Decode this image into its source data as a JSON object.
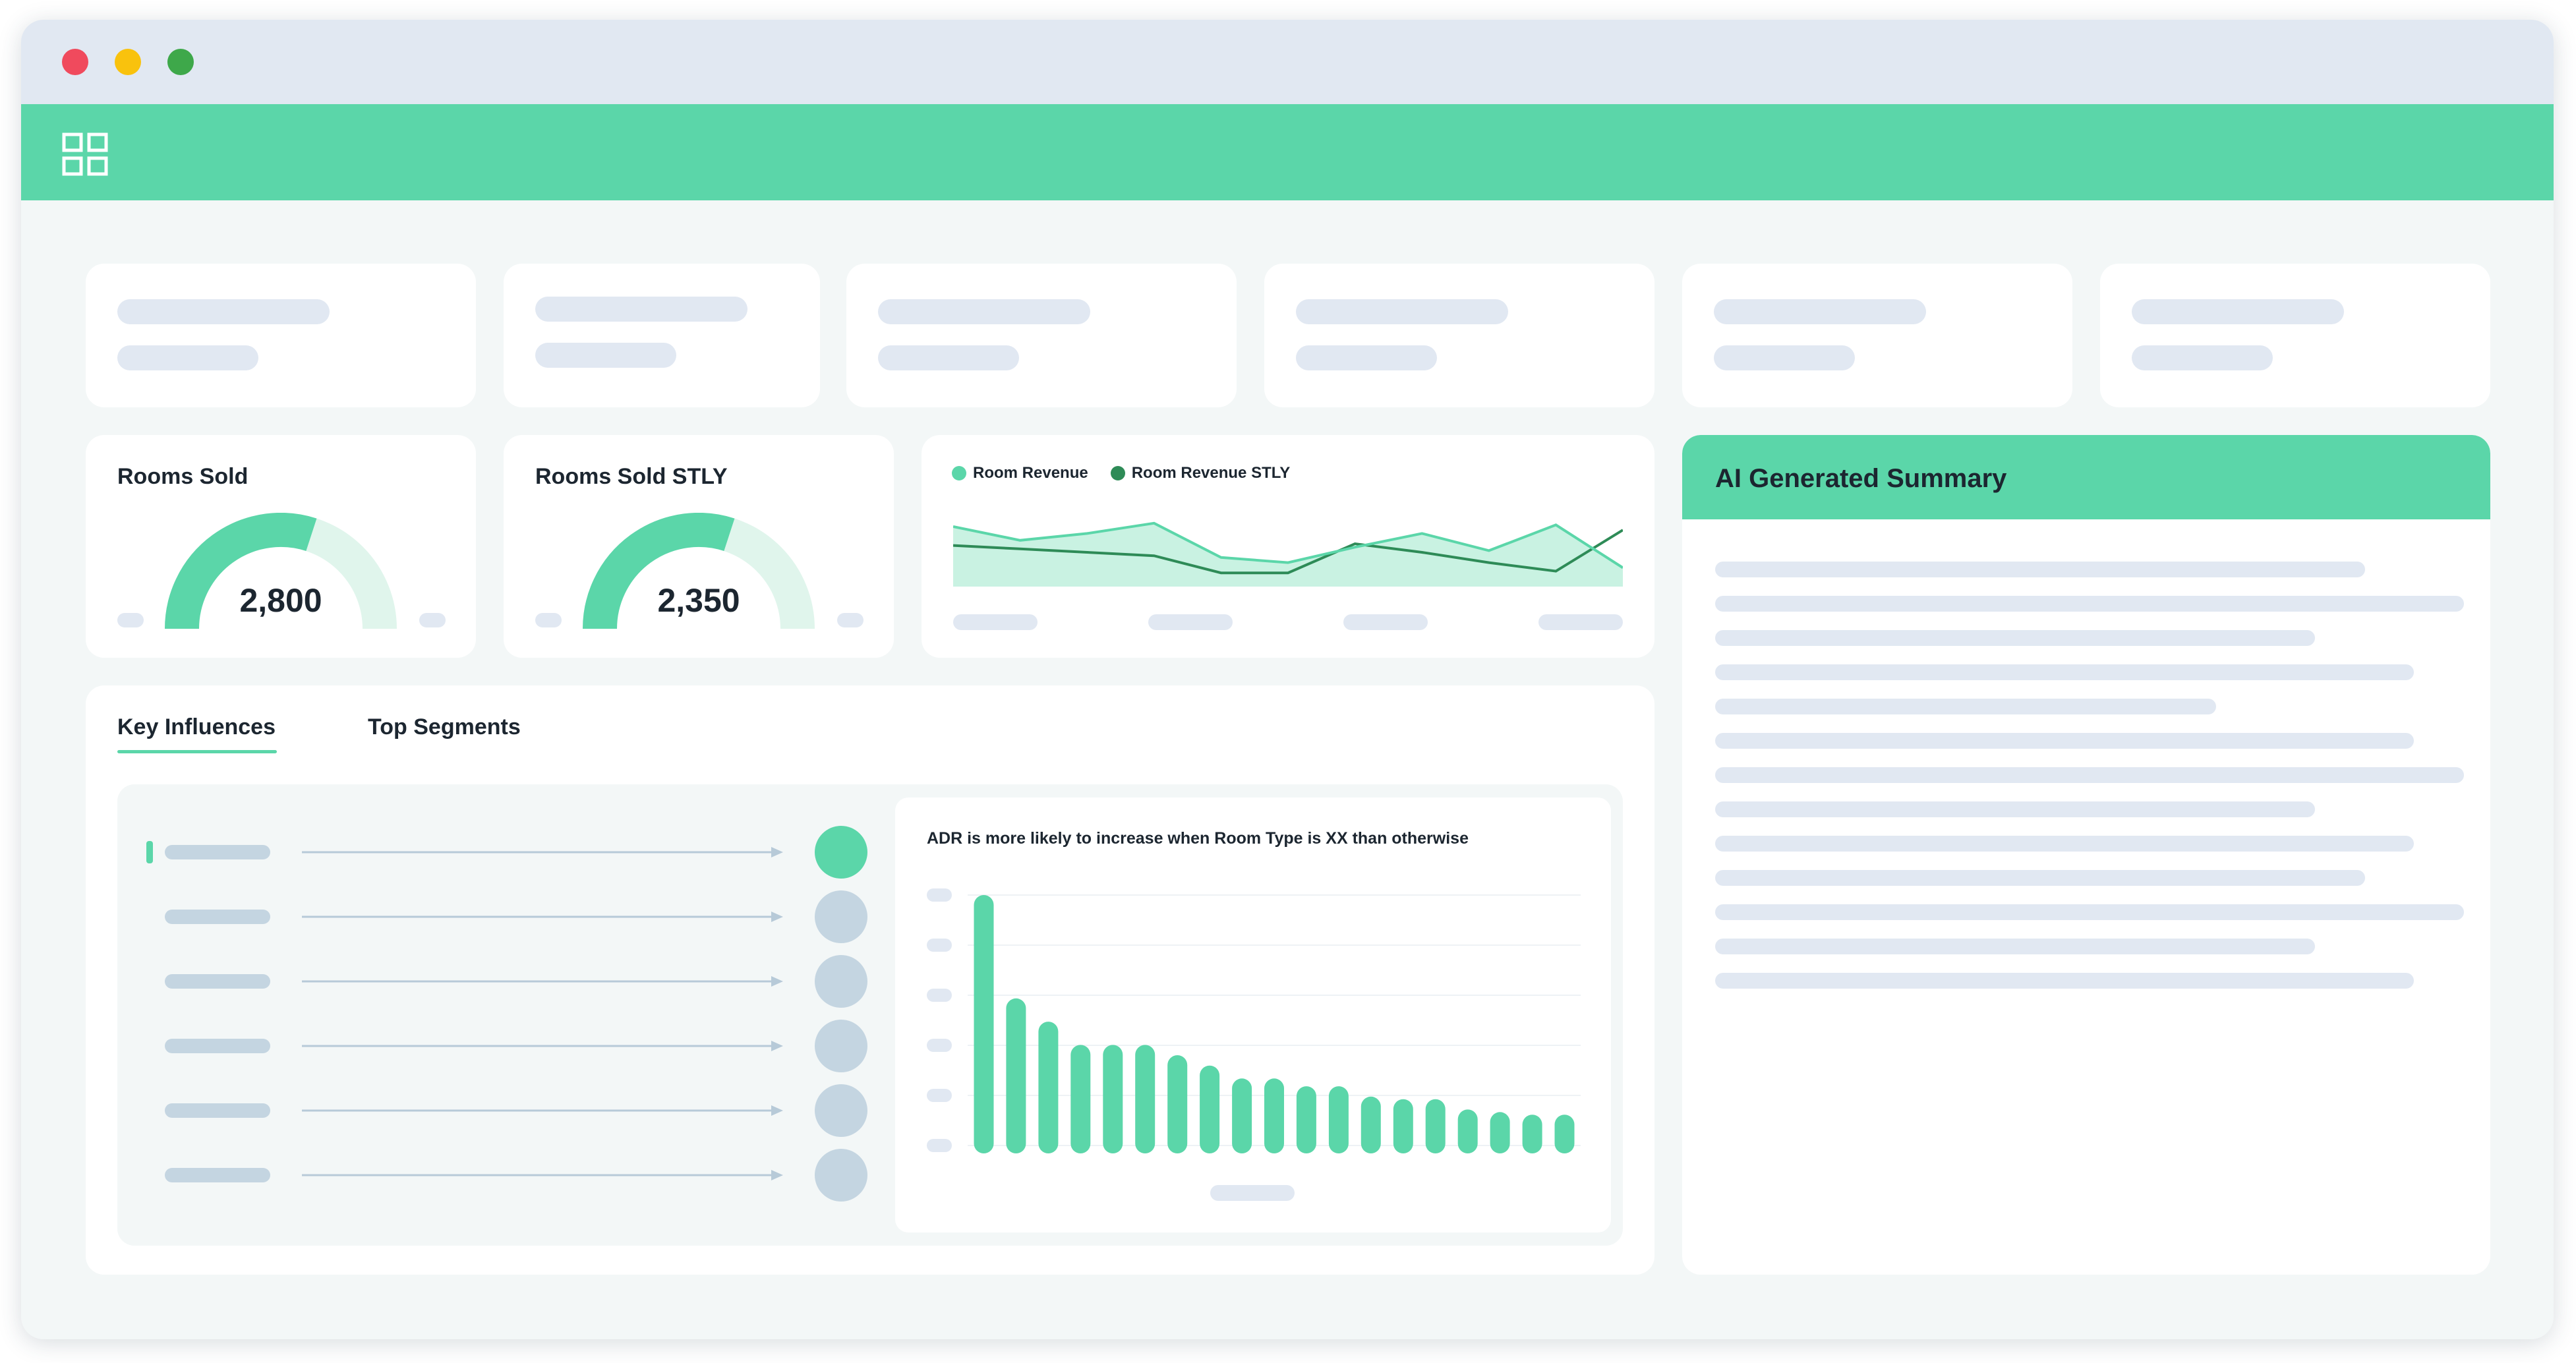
{
  "window": {
    "traffic_lights": [
      {
        "name": "close",
        "color": "#f04a5d"
      },
      {
        "name": "minimize",
        "color": "#f9c20d"
      },
      {
        "name": "maximize",
        "color": "#3ea84a"
      }
    ]
  },
  "appbar": {
    "icon": "apps-grid-icon",
    "color": "#5bd6a9"
  },
  "kpi": {
    "rooms_sold": {
      "title": "Rooms Sold",
      "value": "2,800",
      "fill_fraction": 0.6
    },
    "rooms_sold_stly": {
      "title": "Rooms Sold STLY",
      "value": "2,350",
      "fill_fraction": 0.6
    }
  },
  "revenue_chart": {
    "legend": [
      "Room Revenue",
      "Room Revenue STLY"
    ],
    "colors": {
      "room_revenue": "#5bd6a9",
      "room_revenue_stly": "#2e8b57",
      "area": "#c9f2e2"
    }
  },
  "tabs": {
    "key_influences": "Key Influences",
    "top_segments": "Top Segments"
  },
  "influence_chart": {
    "title": "ADR is more likely to increase when Room Type is XX than otherwise"
  },
  "summary": {
    "title": "AI Generated Summary"
  },
  "chart_data": [
    {
      "type": "area",
      "series": [
        {
          "name": "Room Revenue",
          "values": [
            7,
            5.4,
            6.2,
            7.4,
            3.4,
            2.8,
            4.6,
            6.2,
            4.2,
            7.2,
            2.2
          ]
        },
        {
          "name": "Room Revenue STLY",
          "values": [
            4.8,
            4.4,
            4.0,
            3.6,
            1.6,
            1.6,
            5.0,
            4.0,
            2.8,
            1.8,
            6.6
          ]
        }
      ],
      "ylim": [
        0,
        10
      ]
    },
    {
      "type": "bar",
      "title": "ADR is more likely to increase when Room Type is XX than otherwise",
      "values": [
        100,
        60,
        51,
        42,
        42,
        42,
        38,
        34,
        29,
        29,
        26,
        26,
        22,
        21,
        21,
        17,
        16,
        15,
        15
      ],
      "ylim": [
        0,
        100
      ]
    }
  ]
}
